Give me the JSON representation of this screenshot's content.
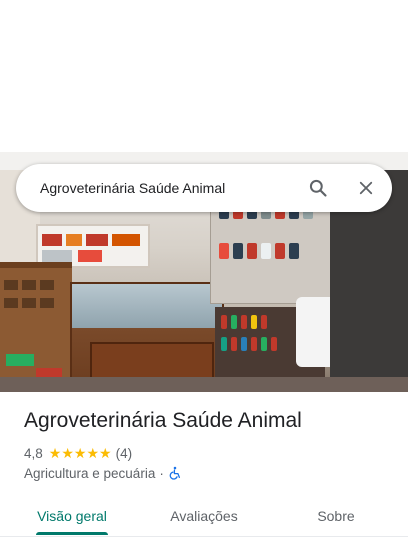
{
  "search": {
    "query": "Agroveterinária Saúde Animal",
    "search_icon": "search-icon",
    "close_icon": "close-icon"
  },
  "place": {
    "name": "Agroveterinária Saúde Animal",
    "rating": "4,8",
    "stars": 5,
    "review_count": "(4)",
    "category": "Agricultura e pecuária",
    "separator": "·",
    "accessibility_icon": "wheelchair-icon"
  },
  "tabs": [
    {
      "label": "Visão geral",
      "active": true
    },
    {
      "label": "Avaliações",
      "active": false
    },
    {
      "label": "Sobre",
      "active": false
    }
  ],
  "colors": {
    "accent": "#00796b",
    "star": "#fbbc04",
    "accessibility": "#1a73e8",
    "text_primary": "#202124",
    "text_secondary": "#5f6368"
  }
}
